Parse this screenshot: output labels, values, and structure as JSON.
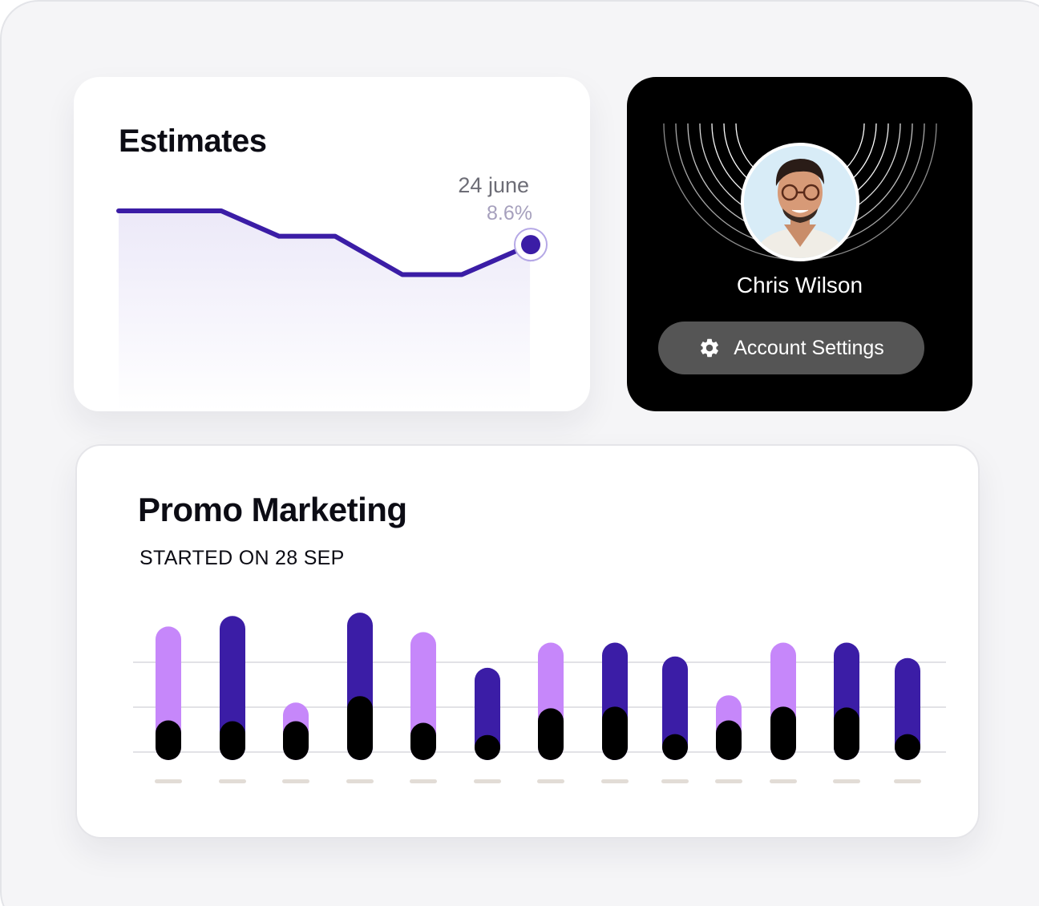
{
  "estimates": {
    "title": "Estimates",
    "marker_date": "24 june",
    "marker_value": "8.6%",
    "colors": {
      "line": "#3b1da6",
      "fill": "#a89be0"
    }
  },
  "profile": {
    "name": "Chris Wilson",
    "account_settings_label": "Account Settings",
    "account_settings_icon": "gear-icon",
    "avatar_background": "#d8ecf7"
  },
  "promo": {
    "title": "Promo Marketing",
    "subtitle": "STARTED ON 28 SEP"
  },
  "chart_data": [
    {
      "type": "line",
      "title": "Estimates",
      "x": [
        0,
        1,
        2,
        3,
        4,
        5,
        6,
        7
      ],
      "values": [
        100,
        100,
        73,
        73,
        32,
        32,
        64,
        64
      ],
      "ylim": [
        0,
        100
      ],
      "annotation": {
        "label": "24 june",
        "value": "8.6%",
        "point_index": 7
      },
      "grid": false
    },
    {
      "type": "bar",
      "title": "Promo Marketing",
      "categories": [
        "",
        "",
        "",
        "",
        "",
        "",
        "",
        "",
        "",
        "",
        "",
        "",
        ""
      ],
      "series": [
        {
          "color_role": "total",
          "colors": [
            "#c687fa",
            "#3b1da6",
            "#c687fa",
            "#3b1da6",
            "#c687fa",
            "#3b1da6",
            "#c687fa",
            "#3b1da6",
            "#3b1da6",
            "#c687fa",
            "#c687fa",
            "#3b1da6",
            "#3b1da6"
          ],
          "values": [
            16.5,
            17.8,
            7.1,
            18.2,
            15.8,
            11.4,
            14.5,
            14.5,
            12.8,
            8.0,
            14.5,
            14.5,
            12.6
          ]
        },
        {
          "color_role": "base",
          "color": "#000000",
          "values": [
            4.9,
            4.8,
            4.8,
            7.9,
            4.6,
            3.1,
            6.4,
            6.6,
            3.2,
            4.9,
            6.6,
            6.5,
            3.2
          ]
        }
      ],
      "ylim": [
        0,
        18
      ],
      "grid": true
    }
  ]
}
